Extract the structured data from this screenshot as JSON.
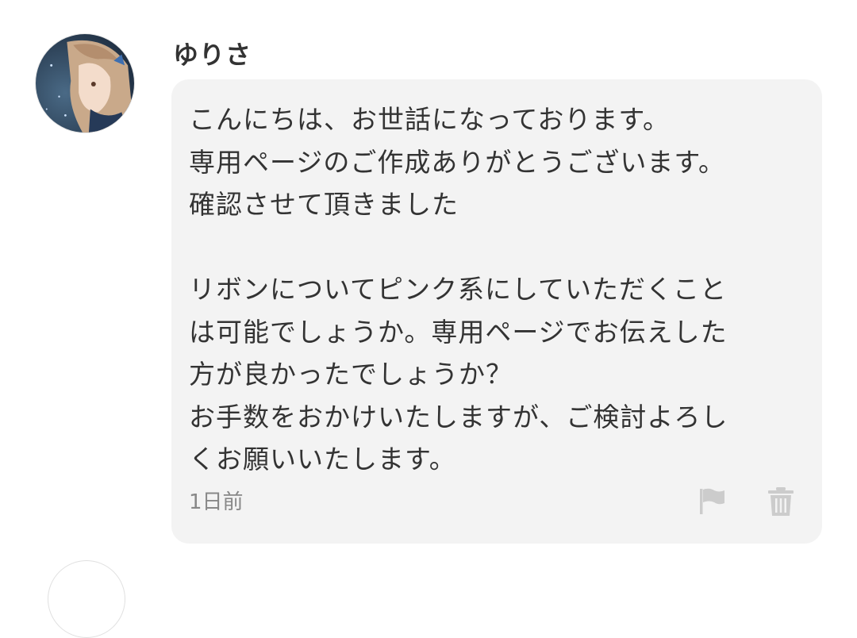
{
  "comment": {
    "username": "ゆりさ",
    "avatar_icon": "user-avatar-image",
    "message": "こんにちは、お世話になっております。\n専用ページのご作成ありがとうございます。\n確認させて頂きました\n\nリボンについてピンク系にしていただくこと\nは可能でしょうか。専用ページでお伝えした\n方が良かったでしょうか？\nお手数をおかけいたしますが、ご検討よろし\nくお願いいたします。",
    "timestamp": "1日前",
    "actions": {
      "flag_icon": "flag-icon",
      "trash_icon": "trash-icon"
    }
  },
  "colors": {
    "bubble_bg": "#f3f3f3",
    "text": "#333333",
    "muted": "#888888",
    "icon": "#cccccc"
  }
}
